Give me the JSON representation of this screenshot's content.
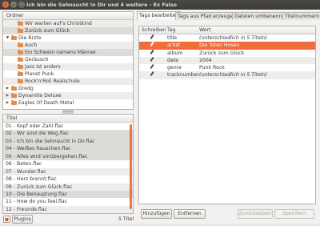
{
  "window": {
    "title": "Ich bin die Sehnsucht in Dir und 4 weitere - Ex Falso",
    "close_glyph": "×",
    "min_glyph": "–",
    "max_glyph": "□"
  },
  "folder_pane": {
    "header": "Ordner",
    "items": [
      {
        "label": "Wir warten auf's Christkind",
        "depth": 2,
        "expander": "",
        "state": "alt"
      },
      {
        "label": "Zurück zum Glück",
        "depth": 2,
        "expander": "",
        "state": "sel"
      },
      {
        "label": "Die Ärzte",
        "depth": 1,
        "expander": "▼",
        "state": ""
      },
      {
        "label": "Auch",
        "depth": 2,
        "expander": "",
        "state": "alt"
      },
      {
        "label": "Ein Schwein namens Männer",
        "depth": 2,
        "expander": "",
        "state": "sel"
      },
      {
        "label": "Geräusch",
        "depth": 2,
        "expander": "",
        "state": ""
      },
      {
        "label": "Jazz ist anders",
        "depth": 2,
        "expander": "",
        "state": "alt"
      },
      {
        "label": "Planet Punk",
        "depth": 2,
        "expander": "",
        "state": ""
      },
      {
        "label": "Rock'n'Roll Realschule",
        "depth": 2,
        "expander": "",
        "state": "alt"
      },
      {
        "label": "Dredg",
        "depth": 1,
        "expander": "▶",
        "state": ""
      },
      {
        "label": "Dynamite Deluxe",
        "depth": 1,
        "expander": "▶",
        "state": "alt"
      },
      {
        "label": "Eagles Of Death Metal",
        "depth": 1,
        "expander": "▶",
        "state": ""
      }
    ]
  },
  "file_pane": {
    "header": "Titel",
    "files": [
      {
        "name": "01 - Kopf oder Zahl.flac",
        "state": ""
      },
      {
        "name": "02 - Wir sind die Weg.flac",
        "state": "sel"
      },
      {
        "name": "03 - Ich bin die Sehnsucht in Dir.flac",
        "state": "sel"
      },
      {
        "name": "04 - Weißes Rauschen.flac",
        "state": "sel"
      },
      {
        "name": "05 - Alles wird vorübergehen.flac",
        "state": "sel"
      },
      {
        "name": "06 - Beten.flac",
        "state": ""
      },
      {
        "name": "07 - Wunder.flac",
        "state": "alt"
      },
      {
        "name": "08 - Herz brennt.flac",
        "state": ""
      },
      {
        "name": "09 - Zurück zum Glück.flac",
        "state": "alt"
      },
      {
        "name": "10 - Die Behauptung.flac",
        "state": "sel"
      },
      {
        "name": "11 - How do you feel.flac",
        "state": ""
      },
      {
        "name": "12 - Freunde.flac",
        "state": "alt"
      }
    ]
  },
  "bottom_left": {
    "plugins_label": "Plugins",
    "count": "5 Titel"
  },
  "tabs": [
    {
      "label": "Tags bearbeiten",
      "active": true
    },
    {
      "label": "Tags aus Pfad erzeugen",
      "active": false
    },
    {
      "label": "Dateien umbenennen",
      "active": false
    },
    {
      "label": "Titelnummern",
      "active": false
    }
  ],
  "tag_table": {
    "col_write": "Schreiben",
    "col_tag": "Tag",
    "col_value": "Wert",
    "rows": [
      {
        "tag": "title",
        "value": "(unterschiedlich in 5 Titeln)",
        "italic": true,
        "state": ""
      },
      {
        "tag": "artist",
        "value": "Die Toten Hosen",
        "italic": false,
        "state": "sel"
      },
      {
        "tag": "album",
        "value": "Zurück zum Glück",
        "italic": false,
        "state": ""
      },
      {
        "tag": "date",
        "value": "2004",
        "italic": false,
        "state": "alt"
      },
      {
        "tag": "genre",
        "value": "Punk Rock",
        "italic": false,
        "state": ""
      },
      {
        "tag": "tracknumber",
        "value": "(unterschiedlich in 5 Titeln)",
        "italic": true,
        "state": "alt"
      }
    ]
  },
  "buttons": {
    "add": "Hinzufügen",
    "remove": "Entfernen",
    "revert": "Zurücksetzen",
    "save": "Speichern"
  },
  "colors": {
    "accent": "#ee6f3a",
    "folder": "#e08d4b"
  }
}
